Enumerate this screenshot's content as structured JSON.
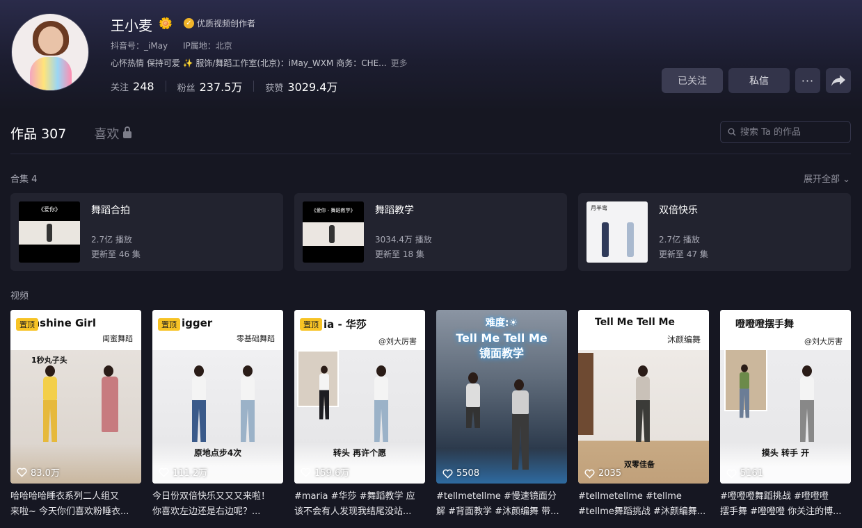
{
  "profile": {
    "name": "王小麦",
    "name_emoji": "🌼",
    "badge": "优质视频创作者",
    "douyin_id": "抖音号：_iMay",
    "ip_location": "IP属地：北京",
    "bio": "心怀热情 保持可爱 ✨ 服饰/舞蹈工作室(北京)：iMay_WXM 商务：CHE...",
    "bio_more": "更多",
    "stats": {
      "following_label": "关注",
      "following": "248",
      "followers_label": "粉丝",
      "followers": "237.5万",
      "likes_label": "获赞",
      "likes": "3029.4万"
    }
  },
  "actions": {
    "followed": "已关注",
    "message": "私信",
    "more": "···"
  },
  "tabs": {
    "works_label": "作品",
    "works_count": "307",
    "likes_label": "喜欢"
  },
  "search": {
    "placeholder": "搜索 Ta 的作品"
  },
  "collections": {
    "title": "合集 4",
    "expand": "展开全部",
    "items": [
      {
        "title": "舞蹈合拍",
        "plays": "2.7亿 播放",
        "updated": "更新至 46 集",
        "thumb_text": "《爱你》"
      },
      {
        "title": "舞蹈教学",
        "plays": "3034.4万 播放",
        "updated": "更新至 18 集",
        "thumb_text": "《爱你 - 舞蹈教学》"
      },
      {
        "title": "双倍快乐",
        "plays": "2.7亿 播放",
        "updated": "更新至 47 集",
        "thumb_text": "月半弯"
      }
    ]
  },
  "videos": {
    "title": "视频",
    "pinned_label": "置顶",
    "items": [
      {
        "heading": "Sunshine Girl",
        "sub": "闺蜜舞蹈",
        "overlay": "1秒丸子头",
        "likes": "83.0万",
        "desc1": "哈哈哈哈睡衣系列二人组又",
        "desc2": "来啦~ 今天你们喜欢粉睡衣..."
      },
      {
        "heading": "igger",
        "sub": "零基础舞蹈",
        "overlay": "原地点步4次",
        "likes": "111.2万",
        "desc1": "今日份双倍快乐又又又来啦！",
        "desc2": "你喜欢左边还是右边呢？..."
      },
      {
        "heading": "ia - 华莎",
        "sub": "@刘大厉害",
        "overlay": "转头 再许个愿",
        "likes": "159.6万",
        "desc1": "#maria #华莎 #舞蹈教学 应",
        "desc2": "该不会有人发现我结尾没站..."
      },
      {
        "heading": "难度:☀",
        "sub": "Tell Me Tell Me 镜面教学",
        "overlay": "",
        "likes": "5508",
        "desc1": "#tellmetellme #慢速镜面分",
        "desc2": "解 #背面教学 #沐颜编舞 带..."
      },
      {
        "heading": "Tell Me Tell Me",
        "sub": "沐颜编舞",
        "overlay": "双零佳备",
        "likes": "2035",
        "desc1": "#tellmetellme #tellme",
        "desc2": "#tellme舞蹈挑战 #沐颜编舞..."
      },
      {
        "heading": "噔噔噔摆手舞",
        "sub": "@刘大厉害",
        "overlay": "摸头 转手 开",
        "likes": "5161",
        "desc1": "#噔噔噔舞蹈挑战 #噔噔噔",
        "desc2": "摆手舞 #噔噔噔 你关注的博..."
      }
    ]
  },
  "colors": {
    "background": "#161722",
    "card": "#22232f",
    "badge_gold": "#f0b429",
    "pin_yellow": "#f7c325"
  }
}
